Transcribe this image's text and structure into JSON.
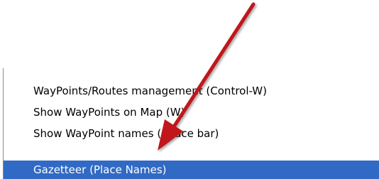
{
  "menu": {
    "items": [
      {
        "label": "WayPoints/Routes management (Control-W)",
        "selected": false
      },
      {
        "label": "Show WayPoints on Map (W)",
        "selected": false
      },
      {
        "label": "Show WayPoint names (Space bar)",
        "selected": false
      },
      {
        "label": "Gazetteer (Place Names)",
        "selected": true
      }
    ]
  },
  "annotation": {
    "arrow_color": "#c0161b"
  },
  "colors": {
    "highlight": "#316ac5",
    "highlight_text": "#ffffff"
  }
}
